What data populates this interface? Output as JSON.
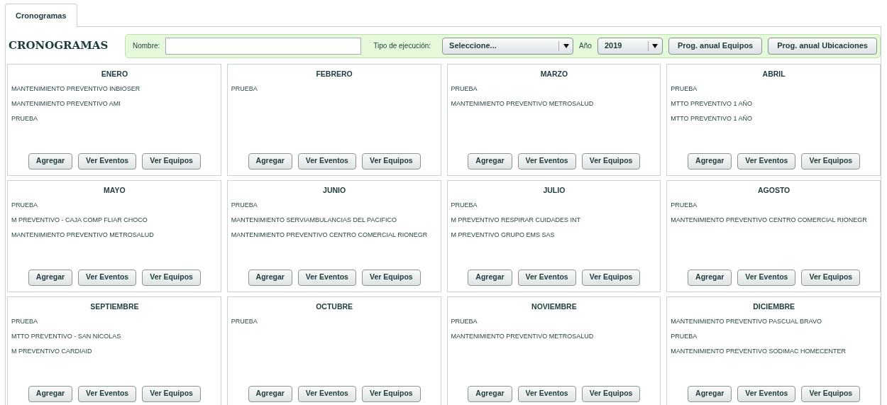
{
  "tabs": [
    {
      "label": "Cronogramas",
      "selected": true
    }
  ],
  "title": "CRONOGRAMAS",
  "filters": {
    "name_label": "Nombre:",
    "type_label": "Tipo de ejecución:",
    "type_value": "Seleccione...",
    "year_label": "Año",
    "year_value": "2019",
    "buttons": [
      "Prog. anual Equipos",
      "Prog. anual Ubicaciones"
    ]
  },
  "months": [
    {
      "name": "ENERO",
      "items": [
        "MANTENIMIENTO PREVENTIVO INBIOSER",
        "MANTENIMIENTO PREVENTIVO AMI",
        "PRUEBA"
      ],
      "buttons": [
        "Agregar",
        "Ver Eventos",
        "Ver Equipos"
      ]
    },
    {
      "name": "FEBRERO",
      "items": [
        "PRUEBA"
      ],
      "buttons": [
        "Agregar",
        "Ver Eventos",
        "Ver Equipos"
      ]
    },
    {
      "name": "MARZO",
      "items": [
        "PRUEBA",
        "MANTENIMIENTO PREVENTIVO METROSALUD"
      ],
      "buttons": [
        "Agregar",
        "Ver Eventos",
        "Ver Equipos"
      ]
    },
    {
      "name": "ABRIL",
      "items": [
        "PRUEBA",
        "MTTO PREVENTIVO 1 AÑO",
        "MTTO PREVENTIVO 1 AÑO"
      ],
      "buttons": [
        "Agregar",
        "Ver Eventos",
        "Ver Equipos"
      ]
    },
    {
      "name": "MAYO",
      "items": [
        "PRUEBA",
        "M PREVENTIVO - CAJA COMP FLIAR CHOCO",
        "MANTENIMIENTO PREVENTIVO METROSALUD"
      ],
      "buttons": [
        "Agregar",
        "Ver Eventos",
        "Ver Equipos"
      ]
    },
    {
      "name": "JUNIO",
      "items": [
        "PRUEBA",
        "MANTENIMIENTO SERVIAMBULANCIAS DEL PACIFICO",
        "MANTENIMIENTO PREVENTIVO CENTRO COMERCIAL RIONEGR"
      ],
      "buttons": [
        "Agregar",
        "Ver Eventos",
        "Ver Equipos"
      ]
    },
    {
      "name": "JULIO",
      "items": [
        "PRUEBA",
        "M PREVENTIVO RESPIRAR CUIDADES INT",
        "M PREVENTIVO GRUPO EMS SAS"
      ],
      "buttons": [
        "Agregar",
        "Ver Eventos",
        "Ver Equipos"
      ]
    },
    {
      "name": "AGOSTO",
      "items": [
        "PRUEBA",
        "MANTENIMIENTO PREVENTIVO CENTRO COMERCIAL RIONEGR"
      ],
      "buttons": [
        "Agregar",
        "Ver Eventos",
        "Ver Equipos"
      ]
    },
    {
      "name": "SEPTIEMBRE",
      "items": [
        "PRUEBA",
        "MTTO PREVENTIVO - SAN NICOLAS",
        "M PREVENTIVO CARDIAID"
      ],
      "buttons": [
        "Agregar",
        "Ver Eventos",
        "Ver Equipos"
      ]
    },
    {
      "name": "OCTUBRE",
      "items": [
        "PRUEBA"
      ],
      "buttons": [
        "Agregar",
        "Ver Eventos",
        "Ver Equipos"
      ]
    },
    {
      "name": "NOVIEMBRE",
      "items": [
        "PRUEBA",
        "MANTENIMIENTO PREVENTIVO METROSALUD"
      ],
      "buttons": [
        "Agregar",
        "Ver Eventos",
        "Ver Equipos"
      ]
    },
    {
      "name": "DICIEMBRE",
      "items": [
        "MANTENIMIENTO PREVENTIVO PASCUAL BRAVO",
        "PRUEBA",
        "MANTENIMIENTO PREVENTIVO SODIMAC HOMECENTER"
      ],
      "buttons": [
        "Agregar",
        "Ver Eventos",
        "Ver Equipos"
      ]
    }
  ]
}
